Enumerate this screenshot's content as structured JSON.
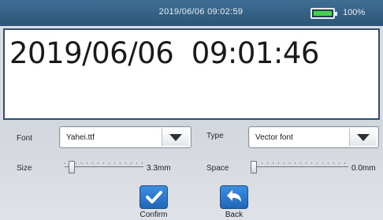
{
  "status": {
    "datetime": "2019/06/06 09:02:59",
    "battery_percent": "100%",
    "battery_level": 1.0
  },
  "preview": {
    "text": "2019/06/06  09:01:46"
  },
  "settings": {
    "font_label": "Font",
    "font_value": "Yahei.ttf",
    "type_label": "Type",
    "type_value": "Vector font",
    "size_label": "Size",
    "size_value": "3.3mm",
    "size_level": 0.05,
    "space_label": "Space",
    "space_value": "0.0mm",
    "space_level": 0.0
  },
  "actions": {
    "confirm_label": "Confirm",
    "back_label": "Back"
  },
  "colors": {
    "statusbar": "#2c5576",
    "accent": "#1f66b8",
    "battery": "#45d14b"
  },
  "icons": [
    "battery-icon",
    "dropdown-arrow-icon",
    "checkmark-icon",
    "back-arrow-icon"
  ]
}
